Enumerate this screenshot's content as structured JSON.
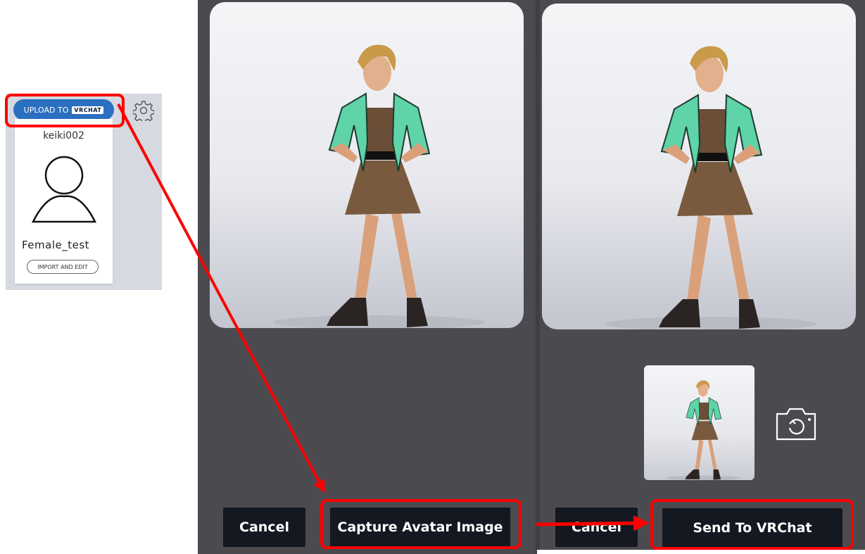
{
  "panel": {
    "upload_label": "UPLOAD TO",
    "upload_logo": "VRCHAT",
    "username": "keiki002",
    "avatar_name": "Female_test",
    "import_label": "IMPORT AND EDIT",
    "icons": [
      "gear-icon",
      "user-avatar-icon"
    ]
  },
  "left_screen": {
    "cancel_label": "Cancel",
    "capture_label": "Capture Avatar Image"
  },
  "right_screen": {
    "cancel_label": "Cancel",
    "send_label": "Send To VRChat",
    "icons": [
      "camera-retake-icon"
    ]
  },
  "colors": {
    "upload_button": "#2b6fc0",
    "app_background": "#4b4b4f",
    "action_button": "#141820",
    "highlight": "#ff0000",
    "jacket": "#5fd4a8",
    "skirt": "#7a5a3e"
  }
}
